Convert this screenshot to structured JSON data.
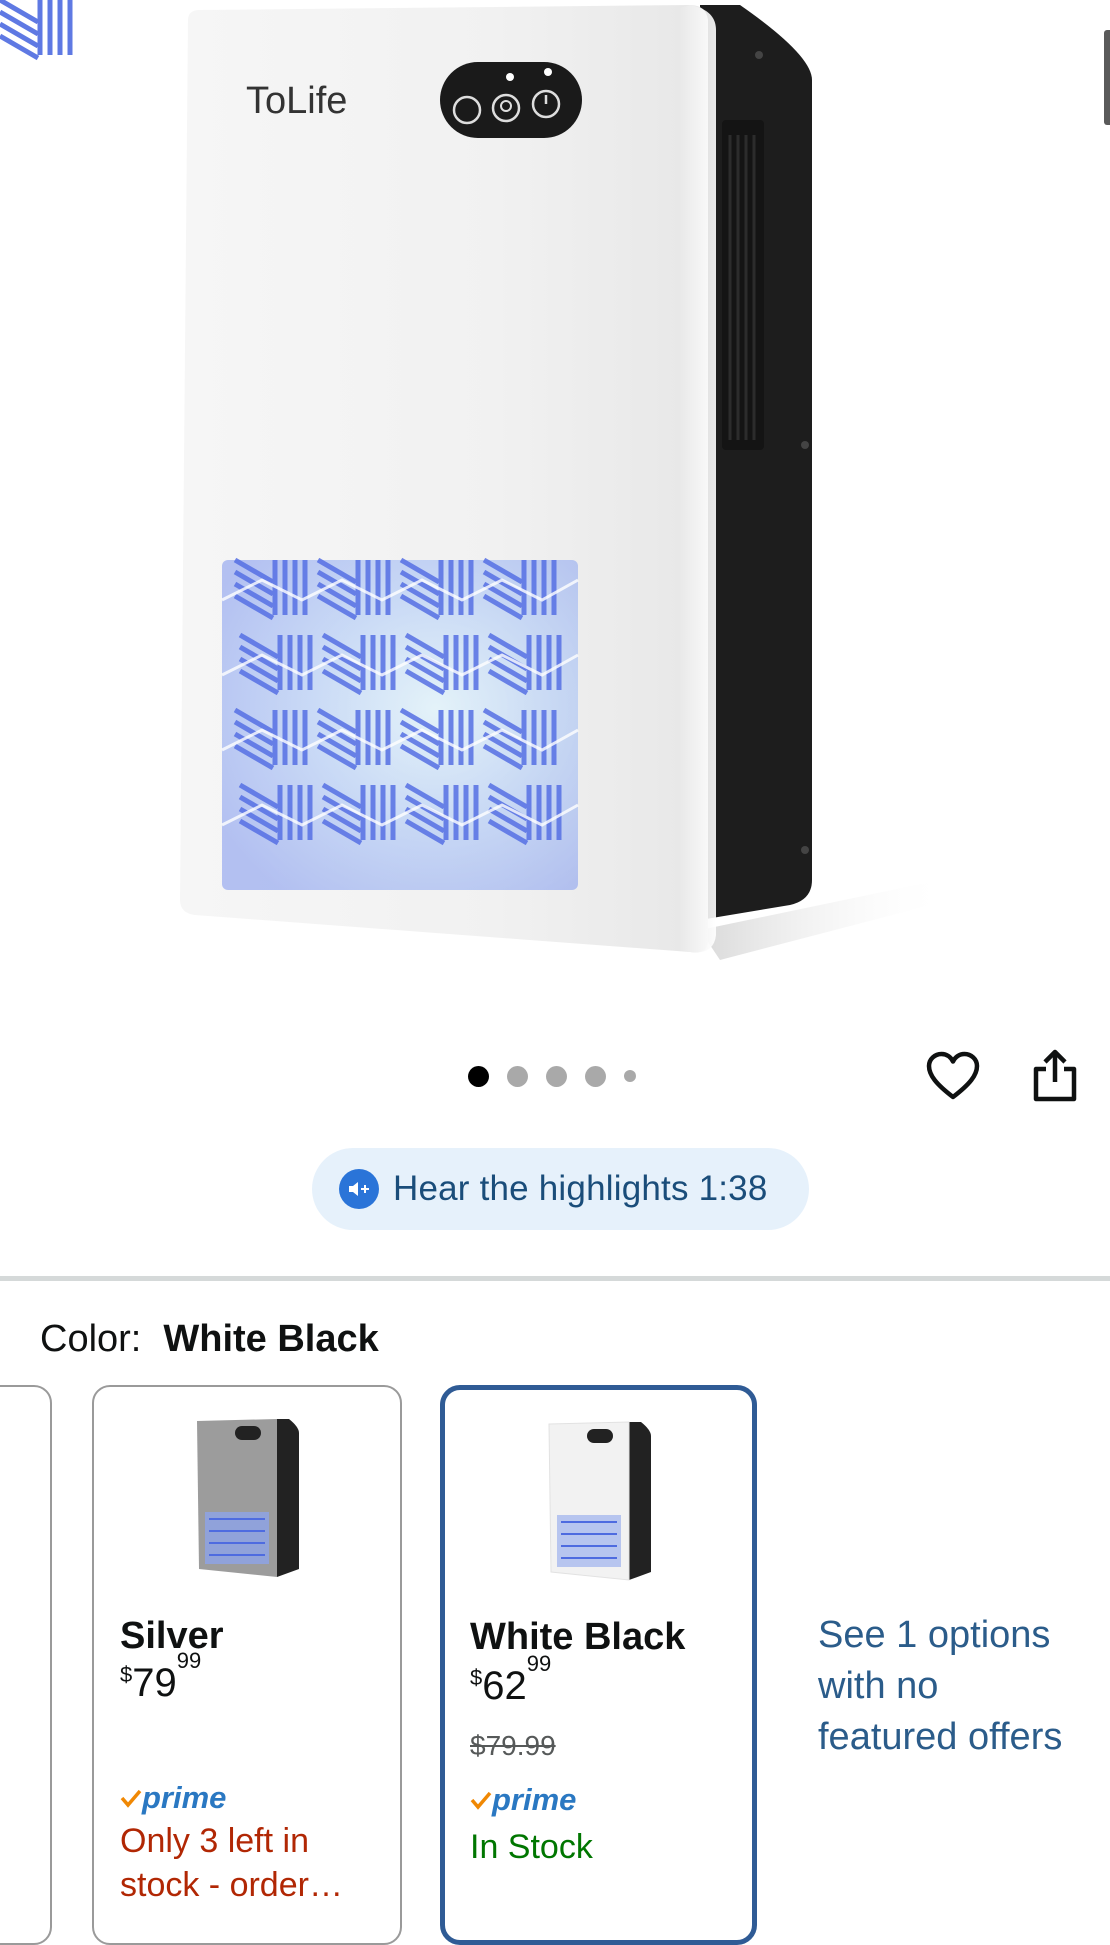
{
  "product": {
    "brand_logo": "ToLife",
    "image_count": 5,
    "active_image_index": 0
  },
  "actions": {
    "wishlist_icon": "heart-icon",
    "share_icon": "share-icon"
  },
  "highlights": {
    "label": "Hear the highlights 1:38",
    "icon": "speaker-sparkle-icon"
  },
  "color_selector": {
    "label": "Color:",
    "selected_value": "White Black",
    "options": [
      {
        "name": "Silver",
        "price_currency": "$",
        "price_whole": "79",
        "price_fraction": "99",
        "prime_label": "prime",
        "stock": "Only 3 left in stock - order…",
        "stock_line1": "Only 3 left in",
        "stock_line2": "stock - order…",
        "stock_color": "#b12704"
      },
      {
        "name": "White Black",
        "price_currency": "$",
        "price_whole": "62",
        "price_fraction": "99",
        "list_price": "$79.99",
        "prime_label": "prime",
        "stock": "In Stock",
        "stock_color": "#007600",
        "selected": true
      }
    ],
    "no_offers_link": "See 1 options with no featured offers"
  },
  "colors": {
    "selected_border": "#2f5b95",
    "link": "#2b5c8a",
    "prime_blue": "#2a78c2",
    "prime_check": "#f08804",
    "highlights_bg": "#e6f1fb"
  }
}
